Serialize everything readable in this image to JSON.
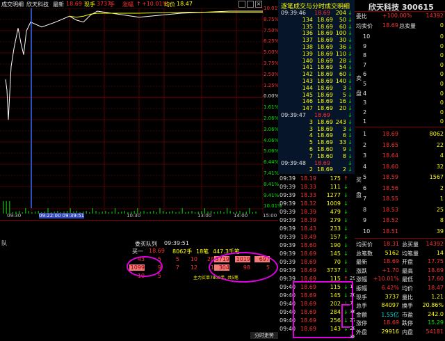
{
  "header": {
    "chart_name": "成交明细",
    "stock_name": "欣天科技",
    "latest_label": "最新",
    "latest": "18.69",
    "hand_label": "现手",
    "hand": "3737",
    "hand_unit": "手",
    "change_label": "涨幅",
    "change": "+10.01%",
    "avg_label": "均价",
    "avg": "18.47",
    "arrow": "↑"
  },
  "chart_pct_labels": [
    "10.01%",
    "8.75%",
    "7.50%",
    "6.25%",
    "5.00%",
    "3.75%",
    "2.50%",
    "1.25%",
    "0.00%",
    "1.61%",
    "2.06%",
    "3.06%",
    "4.06%",
    "5.06%",
    "6.44%",
    "7.41%",
    "8.41%",
    "9.41%",
    "10.01%"
  ],
  "time_labels": [
    "09:30",
    "09:22:00 09:39:51",
    "10:30",
    "13:00",
    "14:00",
    "15:00"
  ],
  "chart_data": {
    "type": "line",
    "title": "",
    "xlabel": "",
    "ylabel": "",
    "y_axis_pct_range": [
      -10.01,
      10.01
    ],
    "price_line_pct": [
      3.1,
      2.0,
      -1.0,
      4.4,
      6.2,
      8.3,
      6.8,
      5.6,
      8.0,
      8.9,
      8.4,
      8.9,
      9.5,
      9.1,
      8.9,
      9.6,
      10.01,
      9.4,
      9.8,
      10.01,
      10.01
    ],
    "avg_line_pct": [
      null,
      null,
      null,
      null,
      null,
      null,
      null,
      null,
      null,
      null,
      null,
      null,
      9.5,
      9.4,
      9.5,
      9.7,
      9.8,
      9.8,
      9.9,
      9.9,
      9.9
    ]
  },
  "bottom_left": {
    "queue_label": "委买队列",
    "queue_time": "09:39:51",
    "side_label": "队",
    "buy1_label": "买一",
    "buy1_price": "18.69",
    "buy1_hands": "8062手",
    "buy1_orders": "18笔",
    "buy1_more": "447.3千笔",
    "queue_rows": [
      [
        "43",
        "5",
        "5",
        "10",
        "28",
        "3719",
        "1019",
        "697"
      ],
      [
        "1099",
        "9",
        "7",
        "12",
        "1",
        "304",
        "98",
        "5"
      ],
      [
        "10",
        "5",
        "",
        "",
        "",
        "",
        "",
        ""
      ]
    ],
    "main_buy_note": "主力买单7800手, 共5笔"
  },
  "tape": {
    "title": "逐笔成交与分时成交明细",
    "rows": [
      {
        "time": "09:39:46",
        "price": "18.69",
        "vol": "20"
      },
      {
        "time": "",
        "price": "134",
        "vol": "18.69"
      },
      {
        "time": "",
        "price": "135",
        "vol": "18.69"
      },
      {
        "time": "",
        "price": "136",
        "vol": "18.69"
      },
      {
        "time": "",
        "price": "137",
        "vol": "18.69"
      },
      {
        "time": "",
        "price": "138",
        "vol": "18.69"
      },
      {
        "time": "",
        "price": "139",
        "vol": "18.69"
      },
      {
        "time": "",
        "price": "140",
        "vol": "18.69"
      },
      {
        "time": "",
        "price": "141",
        "vol": "18.69"
      },
      {
        "time": "",
        "price": "142",
        "vol": "18.69"
      },
      {
        "time": "",
        "price": "143",
        "vol": "18.69"
      },
      {
        "time": "",
        "price": "144",
        "vol": "18.69"
      },
      {
        "time": "",
        "price": "145",
        "vol": "18.69"
      },
      {
        "time": "",
        "price": "146",
        "vol": "18.69"
      },
      {
        "time": "",
        "price": "147",
        "vol": "18.69"
      },
      {
        "time": "09:39:47",
        "price": "18.69",
        "vol": "5"
      },
      {
        "time": "",
        "price": "3",
        "vol": "18.69"
      },
      {
        "time": "",
        "price": "3",
        "vol": "18.69"
      },
      {
        "time": "",
        "price": "4",
        "vol": "18.69"
      },
      {
        "time": "",
        "price": "5",
        "vol": "18.69"
      },
      {
        "time": "",
        "price": "6",
        "vol": "18.60"
      },
      {
        "time": "",
        "price": "7",
        "vol": "18.60"
      },
      {
        "time": "09:39:48",
        "price": "18.69",
        "vol": "5"
      },
      {
        "time": "",
        "price": "2",
        "vol": "18.69"
      }
    ],
    "vol_col": [
      "204",
      "50",
      "60",
      "100",
      "30",
      "36",
      "110",
      "28",
      "54",
      "60",
      "140",
      "3",
      "5",
      "16",
      "20",
      "",
      "243",
      "3",
      "6",
      "33",
      "9",
      "8",
      "",
      "2"
    ],
    "arrows": [
      "↓",
      "↓",
      "↓",
      "↓",
      "↓",
      "↓",
      "↓",
      "↓",
      "↓",
      "↓",
      "↓",
      "↓",
      "↓",
      "↓",
      "↓",
      "↓",
      "↓",
      "↓",
      "↓",
      "↓",
      "↓",
      "↓",
      "↓",
      "↓"
    ]
  },
  "minute_rows": [
    {
      "time": "09:39",
      "price": "18.19",
      "vol": "175",
      "dir": "↑"
    },
    {
      "time": "09:39",
      "price": "18.33",
      "vol": "111",
      "dir": "↓"
    },
    {
      "time": "09:39",
      "price": "18.33",
      "vol": "1277",
      "dir": "↓"
    },
    {
      "time": "09:39",
      "price": "18.32",
      "vol": "1009",
      "dir": "↓"
    },
    {
      "time": "09:39",
      "price": "18.39",
      "vol": "479",
      "dir": "↓"
    },
    {
      "time": "09:39",
      "price": "18.39",
      "vol": "279",
      "dir": "↓"
    },
    {
      "time": "09:39",
      "price": "18.43",
      "vol": "233",
      "dir": "↓"
    },
    {
      "time": "09:39",
      "price": "18.49",
      "vol": "157",
      "dir": "↓"
    },
    {
      "time": "09:39",
      "price": "18.60",
      "vol": "190",
      "dir": "↓"
    },
    {
      "time": "09:39",
      "price": "18.69",
      "vol": "145",
      "dir": "↓"
    },
    {
      "time": "09:39",
      "price": "18.69",
      "vol": "70",
      "dir": "↓"
    },
    {
      "time": "09:39",
      "price": "18.69",
      "vol": "3737",
      "dir": "↓"
    },
    {
      "time": "09:39",
      "price": "18.69",
      "vol": "115",
      "dir": "↑"
    },
    {
      "time": "09:40",
      "price": "18.69",
      "vol": "115",
      "dir": "↓"
    },
    {
      "time": "09:40",
      "price": "18.69",
      "vol": "145",
      "dir": "↓"
    },
    {
      "time": "09:40",
      "price": "18.69",
      "vol": "202",
      "dir": "↓"
    },
    {
      "time": "09:40",
      "price": "18.69",
      "vol": "284",
      "dir": "↓"
    },
    {
      "time": "09:40",
      "price": "18.69",
      "vol": "256",
      "dir": "↓"
    },
    {
      "time": "09:40",
      "price": "18.69",
      "vol": "143",
      "dir": "↓"
    }
  ],
  "minute_side_nums": [
    "29",
    "1",
    "20",
    "7",
    "36",
    "27",
    "28",
    "38"
  ],
  "right": {
    "title": "欣天科技 300615",
    "wei_bi_label": "委比",
    "wei_bi": "+100.00%",
    "wei_cha": "14392",
    "jun_mai_label": "均卖价",
    "jun_mai": "18.69",
    "zong_mai_label": "总卖量",
    "zong_mai": "0",
    "sell_side_label": "卖盘",
    "sell_levels": [
      "10",
      "9",
      "8",
      "7",
      "6",
      "5",
      "4",
      "3",
      "2",
      "1"
    ],
    "sell_values": [
      "0",
      "0",
      "0",
      "0",
      "0",
      "0",
      "0",
      "0",
      "0",
      "0"
    ],
    "buy_side_label": "买盘",
    "buy_levels": [
      "1",
      "2",
      "3",
      "4",
      "5",
      "6",
      "7",
      "8",
      "9",
      "10"
    ],
    "buy_prices": [
      "18.69",
      "18.65",
      "18.64",
      "18.60",
      "18.59",
      "18.56",
      "18.55",
      "18.53",
      "18.52",
      "18.51"
    ],
    "buy_values": [
      "8062",
      "22",
      "4",
      "32",
      "1567",
      "2",
      "1",
      "25",
      "8",
      "39"
    ],
    "stats": [
      [
        "均买价",
        "18.31",
        "总买量",
        "14392"
      ],
      [
        "总笔数",
        "5162",
        "均笔量",
        "14"
      ],
      [
        "最新",
        "18.69",
        "开盘",
        "17.75"
      ],
      [
        "涨跌",
        "+1.70",
        "最高",
        "18.69"
      ],
      [
        "涨幅",
        "+10.01%",
        "最低",
        "17.60"
      ],
      [
        "振幅",
        "6.42%",
        "均价",
        "18.47"
      ],
      [
        "现手",
        "3737",
        "量比",
        "1.21"
      ],
      [
        "总手",
        "84097",
        "换手",
        "20.86%"
      ],
      [
        "金额",
        "1.55亿",
        "市盈",
        "242.0"
      ],
      [
        "涨停",
        "18.69",
        "跌停",
        "15.29"
      ],
      [
        "外盘",
        "29916",
        "内盘",
        "54181"
      ]
    ]
  },
  "footer_tab": "分时走势"
}
